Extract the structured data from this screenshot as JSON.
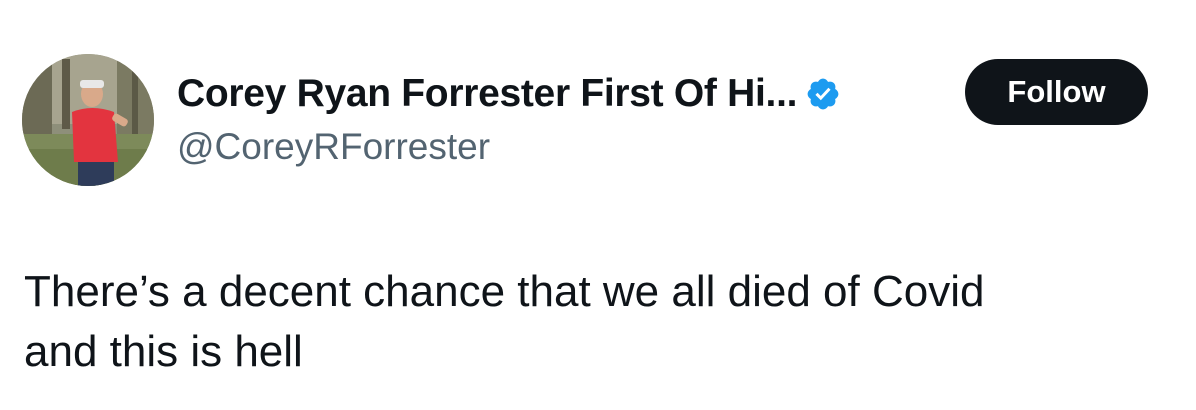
{
  "tweet": {
    "author": {
      "display_name": "Corey Ryan Forrester First Of Hi...",
      "handle": "@CoreyRForrester",
      "verified": true,
      "avatar_icon": "profile-photo"
    },
    "follow_label": "Follow",
    "text": "There’s a decent chance that we all died of Covid\nand this is hell"
  },
  "colors": {
    "text_primary": "#0f1419",
    "text_secondary": "#536471",
    "verified_blue": "#1d9bf0",
    "follow_bg": "#0f1419",
    "follow_text": "#ffffff",
    "background": "#ffffff"
  }
}
